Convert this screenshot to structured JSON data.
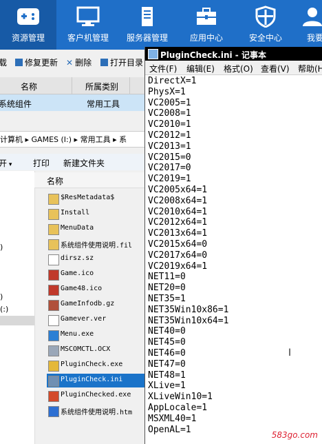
{
  "topnav": {
    "items": [
      {
        "label": "资源管理",
        "icon": "gamepad-icon"
      },
      {
        "label": "客户机管理",
        "icon": "monitor-icon"
      },
      {
        "label": "服务器管理",
        "icon": "server-icon"
      },
      {
        "label": "应用中心",
        "icon": "toolbox-icon"
      },
      {
        "label": "安全中心",
        "icon": "shield-icon"
      },
      {
        "label": "我要",
        "icon": "user-icon"
      }
    ]
  },
  "toolbar": {
    "download": "载",
    "repair": "修复更新",
    "delete": "删除",
    "open_dir": "打开目录"
  },
  "table": {
    "headers": [
      "名称",
      "所属类别"
    ],
    "row": {
      "name": "系统组件",
      "category": "常用工具"
    }
  },
  "breadcrumb": {
    "computer": "计算机",
    "drive": "GAMES (I:)",
    "folder": "常用工具",
    "tail": "系"
  },
  "explorer_toolbar": {
    "open": "开",
    "print": "印",
    "print_prefix": "打",
    "new_folder": "新建文件夹"
  },
  "file_list": {
    "header": "名称",
    "files": [
      {
        "name": "$ResMetadata$",
        "icon": "folder-icon"
      },
      {
        "name": "Install",
        "icon": "folder-icon"
      },
      {
        "name": "MenuData",
        "icon": "folder-icon"
      },
      {
        "name": "系统组件使用说明.fil",
        "icon": "folder-icon"
      },
      {
        "name": "dirsz.sz",
        "icon": "document-icon"
      },
      {
        "name": "Game.ico",
        "icon": "image-icon"
      },
      {
        "name": "Game48.ico",
        "icon": "image-icon"
      },
      {
        "name": "GameInfodb.gz",
        "icon": "archive-icon"
      },
      {
        "name": "Gamever.ver",
        "icon": "document-icon"
      },
      {
        "name": "Menu.exe",
        "icon": "app-icon"
      },
      {
        "name": "MSCOMCTL.OCX",
        "icon": "component-icon"
      },
      {
        "name": "PluginCheck.exe",
        "icon": "puzzle-icon"
      },
      {
        "name": "PluginCheck.ini",
        "icon": "settings-file-icon"
      },
      {
        "name": "PluginChecked.exe",
        "icon": "unknown-file-icon"
      },
      {
        "name": "系统组件使用说明.htm",
        "icon": "web-page-icon"
      }
    ],
    "selected_index": 12
  },
  "tree": {
    "fragments": [
      ")",
      ")",
      "(:)"
    ]
  },
  "notepad": {
    "title": "PluginCheck.ini - 记事本",
    "menu": [
      "文件(F)",
      "编辑(E)",
      "格式(O)",
      "查看(V)",
      "帮助(H"
    ],
    "lines": [
      "DirectX=1",
      "PhysX=1",
      "VC2005=1",
      "VC2008=1",
      "VC2010=1",
      "VC2012=1",
      "VC2013=1",
      "VC2015=0",
      "VC2017=0",
      "VC2019=1",
      "VC2005x64=1",
      "VC2008x64=1",
      "VC2010x64=1",
      "VC2012x64=1",
      "VC2013x64=1",
      "VC2015x64=0",
      "VC2017x64=0",
      "VC2019x64=1",
      "NET11=0",
      "NET20=0",
      "NET35=1",
      "NET35Win10x86=1",
      "NET35Win10x64=1",
      "NET40=0",
      "NET45=0",
      "NET46=0",
      "NET47=0",
      "NET48=1",
      "XLive=1",
      "XLiveWin10=1",
      "AppLocale=1",
      "MSXML40=1",
      "OpenAL=1"
    ]
  },
  "watermark": "583go.com",
  "colors": {
    "nav_bg": "#1f6fc8",
    "nav_active": "#175aa6",
    "selection": "#1a73c9",
    "row_highlight": "#cce4f7"
  }
}
